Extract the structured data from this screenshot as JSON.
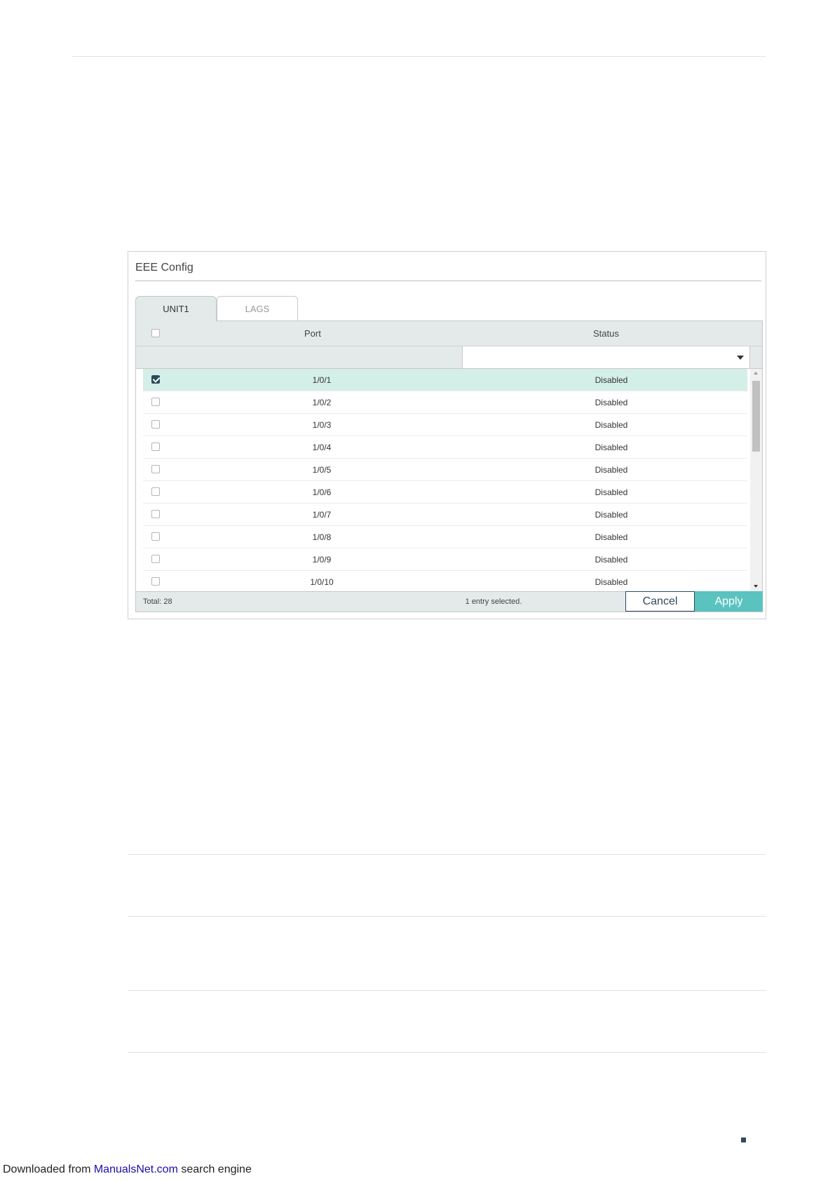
{
  "panel": {
    "title": "EEE Config",
    "tabs": [
      {
        "label": "UNIT1",
        "active": true
      },
      {
        "label": "LAGS",
        "active": false
      }
    ]
  },
  "table": {
    "columns": {
      "port": "Port",
      "status": "Status"
    },
    "filter": {
      "status_value": ""
    },
    "rows": [
      {
        "port": "1/0/1",
        "status": "Disabled",
        "checked": true
      },
      {
        "port": "1/0/2",
        "status": "Disabled",
        "checked": false
      },
      {
        "port": "1/0/3",
        "status": "Disabled",
        "checked": false
      },
      {
        "port": "1/0/4",
        "status": "Disabled",
        "checked": false
      },
      {
        "port": "1/0/5",
        "status": "Disabled",
        "checked": false
      },
      {
        "port": "1/0/6",
        "status": "Disabled",
        "checked": false
      },
      {
        "port": "1/0/7",
        "status": "Disabled",
        "checked": false
      },
      {
        "port": "1/0/8",
        "status": "Disabled",
        "checked": false
      },
      {
        "port": "1/0/9",
        "status": "Disabled",
        "checked": false
      },
      {
        "port": "1/0/10",
        "status": "Disabled",
        "checked": false
      }
    ],
    "footer": {
      "total": "Total: 28",
      "selected": "1 entry selected.",
      "cancel_label": "Cancel",
      "apply_label": "Apply"
    }
  },
  "footer": {
    "prefix": "Downloaded from ",
    "link": "ManualsNet.com",
    "suffix": " search engine"
  },
  "colors": {
    "accent": "#5ac3c0",
    "dark": "#2e4a5c",
    "selected_row": "#d4efe8",
    "header_bg": "#e4e9e9"
  }
}
